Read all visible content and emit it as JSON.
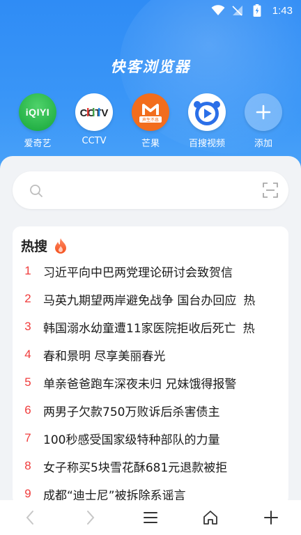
{
  "status_bar": {
    "time": "1:43"
  },
  "app": {
    "title": "快客浏览器"
  },
  "shortcuts": [
    {
      "label": "爱奇艺",
      "icon": "iqiyi-logo-icon",
      "logo_text": "iQIYI"
    },
    {
      "label": "CCTV",
      "icon": "cctv-logo-icon",
      "logo_text": "CCTV"
    },
    {
      "label": "芒果",
      "icon": "mango-logo-icon",
      "logo_text": "声生不息"
    },
    {
      "label": "百搜视频",
      "icon": "baisou-video-logo-icon"
    },
    {
      "label": "添加",
      "icon": "plus-icon"
    }
  ],
  "search": {
    "placeholder": ""
  },
  "hot": {
    "title": "热搜",
    "items": [
      {
        "rank": "1",
        "text": "习近平向中巴两党理论研讨会致贺信",
        "tag": ""
      },
      {
        "rank": "2",
        "text": "马英九期望两岸避免战争 国台办回应",
        "tag": "热"
      },
      {
        "rank": "3",
        "text": "韩国溺水幼童遭11家医院拒收后死亡",
        "tag": "热"
      },
      {
        "rank": "4",
        "text": "春和景明 尽享美丽春光",
        "tag": ""
      },
      {
        "rank": "5",
        "text": "单亲爸爸跑车深夜未归 兄妹饿得报警",
        "tag": ""
      },
      {
        "rank": "6",
        "text": "两男子欠款750万败诉后杀害债主",
        "tag": ""
      },
      {
        "rank": "7",
        "text": "100秒感受国家级特种部队的力量",
        "tag": ""
      },
      {
        "rank": "8",
        "text": "女子称买5块雪花酥681元退款被拒",
        "tag": ""
      },
      {
        "rank": "9",
        "text": "成都“迪士尼”被拆除系谣言",
        "tag": ""
      }
    ]
  },
  "colors": {
    "header_blue": "#2f8cf5",
    "rank_red": "#f03c3c"
  }
}
